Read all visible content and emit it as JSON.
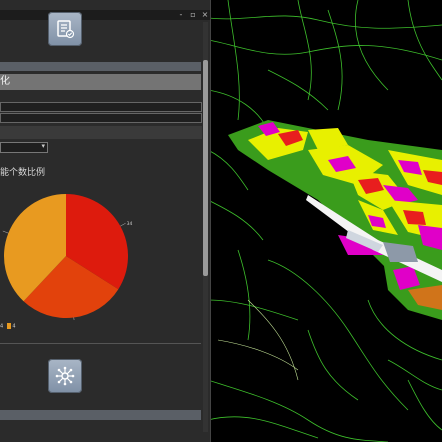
{
  "window": {
    "minimize": "-",
    "restore": "▫",
    "close": "×"
  },
  "panel": {
    "top_tool_icon": "document-check-icon",
    "section_title": "化",
    "dropdown_value": "",
    "chart_title": "能个数比例",
    "bottom_tool_icon": "network-hub-icon"
  },
  "chart_data": {
    "type": "pie",
    "title": "能个数比例",
    "slices": [
      {
        "label": "34",
        "color": "#dd1b0d"
      },
      {
        "label": "28",
        "color": "#e2420c"
      },
      {
        "label": "4",
        "color": "#e89a20"
      }
    ],
    "values": [
      34,
      28,
      38
    ],
    "legend": [
      "4",
      "4"
    ]
  },
  "colors": {
    "panel_bg": "#2b2b2b",
    "map_bg": "#000000",
    "road": "#4cd13a",
    "residential": "#e8f000",
    "commercial": "#e000c8",
    "public": "#e81e1e",
    "green": "#3a9c1c"
  }
}
